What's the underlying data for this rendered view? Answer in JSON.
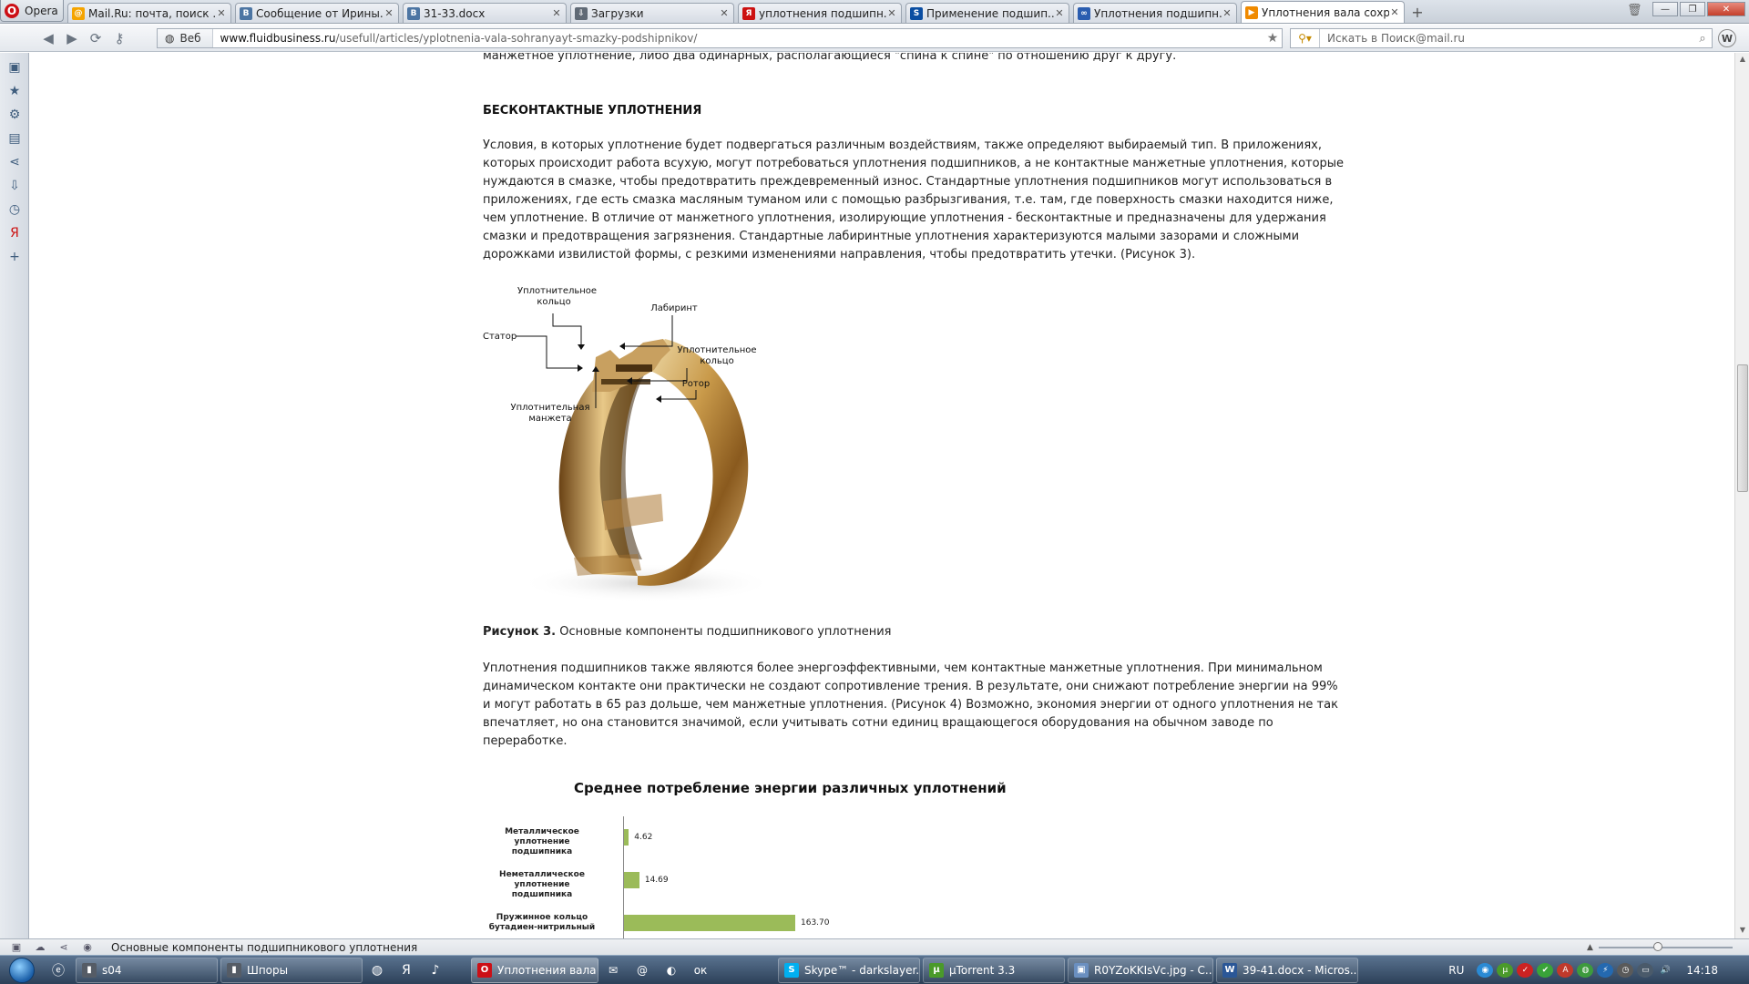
{
  "browser": {
    "menu_label": "Opera",
    "tabs": [
      {
        "title": "Mail.Ru: почта, поиск ...",
        "icon": "mailru-icon",
        "color": "#f5a400",
        "glyph": "@"
      },
      {
        "title": "Сообщение от Ирины...",
        "icon": "vk-icon",
        "color": "#4c75a3",
        "glyph": "B"
      },
      {
        "title": "31-33.docx",
        "icon": "vk-icon",
        "color": "#4c75a3",
        "glyph": "B"
      },
      {
        "title": "Загрузки",
        "icon": "downloads-icon",
        "color": "#606a76",
        "glyph": "⇩"
      },
      {
        "title": "уплотнения подшипн...",
        "icon": "yandex-icon",
        "color": "#cc1111",
        "glyph": "Я"
      },
      {
        "title": "Применение подшип...",
        "icon": "skf-icon",
        "color": "#0b4ea2",
        "glyph": "S"
      },
      {
        "title": "Уплотнения подшипн...",
        "icon": "link-icon",
        "color": "#2a5db0",
        "glyph": "∞"
      },
      {
        "title": "Уплотнения вала сохр...",
        "icon": "fluidbusiness-icon",
        "color": "#f08a00",
        "glyph": "▶",
        "active": true
      }
    ],
    "nav": {
      "web_badge": "Веб",
      "url_domain": "www.fluidbusiness.ru",
      "url_path": "/usefull/articles/yplotnenia-vala-sohranyayt-smazky-podshipnikov/",
      "search_placeholder": "Искать в Поиск@mail.ru"
    },
    "status_text": "Основные компоненты подшипникового уплотнения"
  },
  "article": {
    "cut_line": "манжетное уплотнение, либо два одинарных, располагающиеся \"спина к спине\" по отношению друг к другу.",
    "heading": "БЕСКОНТАКТНЫЕ УПЛОТНЕНИЯ",
    "para1_lines": [
      "Условия, в которых уплотнение будет подвергаться различным воздействиям, также определяют выбираемый тип. В приложениях,",
      "которых происходит работа всухую, могут потребоваться уплотнения подшипников, а не контактные манжетные уплотнения, которые",
      "нуждаются в смазке, чтобы предотвратить преждевременный износ. Стандартные уплотнения подшипников могут использоваться в",
      "приложениях, где есть смазка масляным туманом или с помощью разбрызгивания, т.е. там, где поверхность смазки находится ниже,",
      "чем уплотнение. В отличие от манжетного уплотнения, изолирующие уплотнения - бесконтактные и предназначены для удержания",
      "смазки и предотвращения загрязнения. Стандартные лабиринтные уплотнения характеризуются малыми зазорами и сложными",
      "дорожками извилистой формы, с резкими изменениями направления, чтобы предотвратить утечки. (Рисунок 3)."
    ],
    "figure_labels": {
      "seal_ring_top": "Уплотнительное\nкольцо",
      "labyrinth": "Лабиринт",
      "stator": "Статор",
      "seal_ring_right": "Уплотнительное\nкольцо",
      "rotor": "Ротор",
      "cuff": "Уплотнительная\nманжета"
    },
    "caption_bold": "Рисунок 3.",
    "caption_text": " Основные компоненты подшипникового уплотнения",
    "para2_lines": [
      "Уплотнения подшипников также являются более энергоэффективными, чем контактные манжетные уплотнения. При минимальном",
      "динамическом контакте они практически не создают сопротивление трения. В результате, они снижают потребление энергии на 99%",
      "и могут работать в 65 раз дольше, чем манжетные уплотнения. (Рисунок 4) Возможно, экономия энергии от одного уплотнения не так",
      "впечатляет, но она становится значимой, если учитывать сотни единиц вращающегося оборудования на обычном заводе по",
      "переработке."
    ]
  },
  "chart_data": {
    "type": "bar",
    "orientation": "horizontal",
    "title": "Среднее потребление энергии различных уплотнений",
    "categories": [
      "Металлическое\nуплотнение подшипника",
      "Неметаллическое\nуплотнение подшипника",
      "Пружинное кольцо\nбутадиен-нитрильный"
    ],
    "values": [
      4.62,
      14.69,
      163.7
    ],
    "value_labels": [
      "4.62",
      "14.69",
      "163.70"
    ],
    "color": "#9bbb59",
    "visible_xlim": [
      0,
      163.7
    ]
  },
  "taskbar": {
    "buttons": [
      {
        "label": "s04",
        "color": "#555c66",
        "glyph": "▮"
      },
      {
        "label": "Шпоры",
        "color": "#555c66",
        "glyph": "▮"
      },
      {
        "label": "Уплотнения вала со...",
        "color": "#cc0f16",
        "glyph": "O",
        "active": true
      },
      {
        "label": "Skype™ - darkslayer...",
        "color": "#00aff0",
        "glyph": "S"
      },
      {
        "label": "µTorrent 3.3",
        "color": "#4a9a2a",
        "glyph": "µ"
      },
      {
        "label": "R0YZoKKIsVc.jpg - С...",
        "color": "#6a8fc0",
        "glyph": "▣"
      },
      {
        "label": "39-41.docx - Micros...",
        "color": "#2b5797",
        "glyph": "W"
      }
    ],
    "language": "RU",
    "time": "14:18"
  }
}
